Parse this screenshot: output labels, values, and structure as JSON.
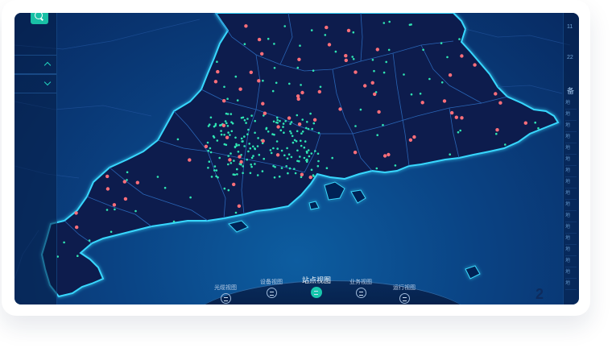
{
  "window": {
    "title": ""
  },
  "left_panel": {
    "search_icon": "search-icon",
    "rows": [
      {
        "icon": "chevron-up-icon"
      },
      {
        "icon": "chevron-down-icon"
      }
    ]
  },
  "right_panel": {
    "top_numbers": [
      "11",
      "22"
    ],
    "heading_char": "备",
    "items": [
      "地",
      "地",
      "地",
      "地",
      "地",
      "地",
      "地",
      "地",
      "地",
      "地",
      "地",
      "地",
      "地",
      "地",
      "地",
      "地",
      "地"
    ]
  },
  "bottom_nav": {
    "items": [
      {
        "label": "光缆视图",
        "icon": "cable-icon",
        "active": false
      },
      {
        "label": "设备视图",
        "icon": "device-icon",
        "active": false
      },
      {
        "label": "站点视图",
        "icon": "site-icon",
        "active": true
      },
      {
        "label": "业务视图",
        "icon": "service-icon",
        "active": false
      },
      {
        "label": "运行视图",
        "icon": "run-icon",
        "active": false
      }
    ]
  },
  "colors": {
    "background_deep": "#082a62",
    "land": "#071e4d",
    "coast_glow": "#38d7ff",
    "border_lines": "#2f72c8",
    "site_green": "#2fe6b4",
    "site_red": "#ff6f7a",
    "accent_teal": "#19c0a6"
  }
}
